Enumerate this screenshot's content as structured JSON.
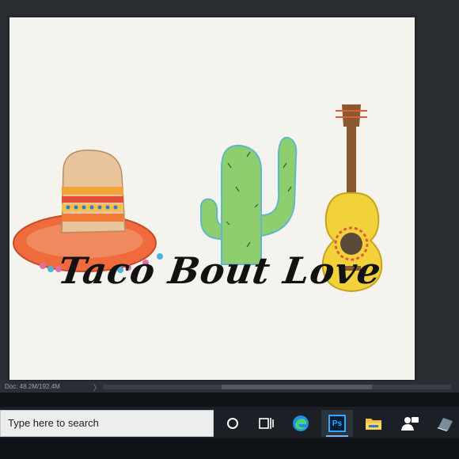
{
  "artwork": {
    "title": "Taco Bout Love",
    "colors": {
      "sombrero_crown": "#e9c39a",
      "sombrero_brim": "#ef6a3c",
      "cactus": "#8fce6e",
      "guitar_body": "#f2d23a",
      "guitar_neck": "#8a5a2e"
    }
  },
  "photoshop": {
    "status": {
      "doc_size": "Doc: 48.2M/192.4M",
      "arrow": "〉"
    }
  },
  "taskbar": {
    "search_placeholder": "Type here to search",
    "apps": [
      {
        "name": "cortana",
        "icon": "circle-icon"
      },
      {
        "name": "task-view",
        "icon": "task-view-icon"
      },
      {
        "name": "edge",
        "icon": "edge-icon"
      },
      {
        "name": "photoshop",
        "icon": "ps-icon",
        "label": "Ps",
        "active": true
      },
      {
        "name": "file-explorer",
        "icon": "folder-icon"
      },
      {
        "name": "people",
        "icon": "people-icon"
      },
      {
        "name": "extra-app",
        "icon": "app-icon"
      }
    ]
  }
}
